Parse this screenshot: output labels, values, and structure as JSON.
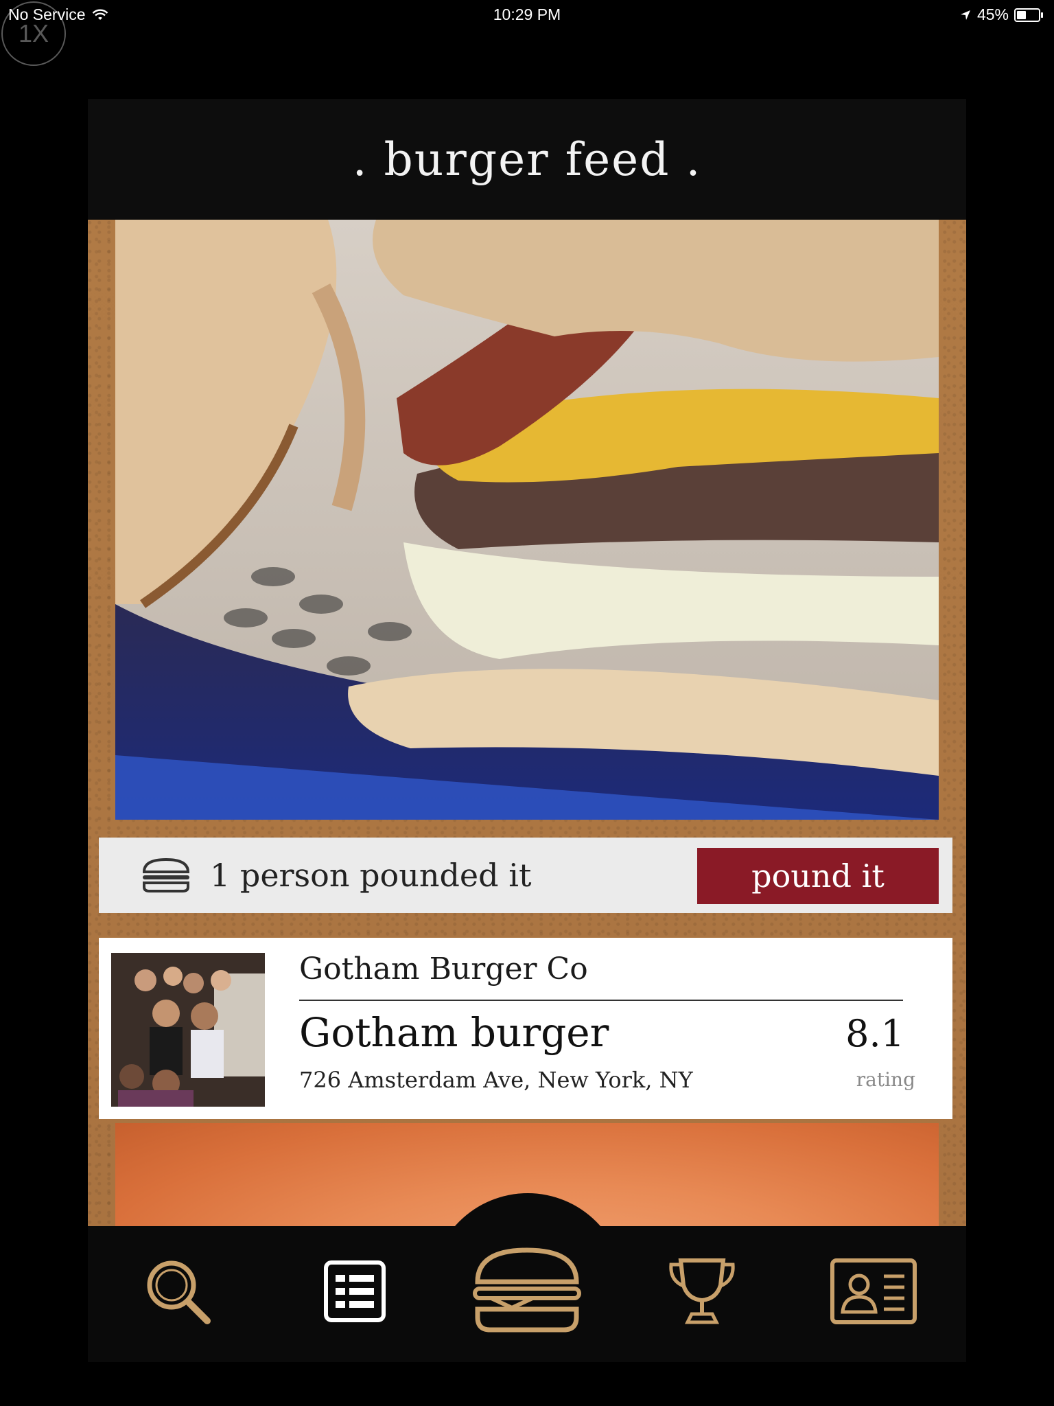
{
  "status_bar": {
    "carrier": "No Service",
    "time": "10:29 PM",
    "battery": "45%",
    "battery_level": 0.45,
    "zoom_badge": "1X"
  },
  "header": {
    "title": ". burger feed ."
  },
  "post": {
    "pound_count_text": "1 person pounded it",
    "pound_button": "pound it",
    "venue": "Gotham Burger Co",
    "burger_name": "Gotham burger",
    "score": "8.1",
    "address": "726 Amsterdam Ave, New York, NY",
    "rating_label": "rating"
  },
  "nav": {
    "items": [
      "search-icon",
      "list-icon",
      "burger-icon",
      "trophy-icon",
      "profile-card-icon"
    ],
    "active": "list-icon"
  },
  "colors": {
    "accent": "#8a1a26",
    "icon_gold": "#c8a06a",
    "cork": "#a87240"
  }
}
